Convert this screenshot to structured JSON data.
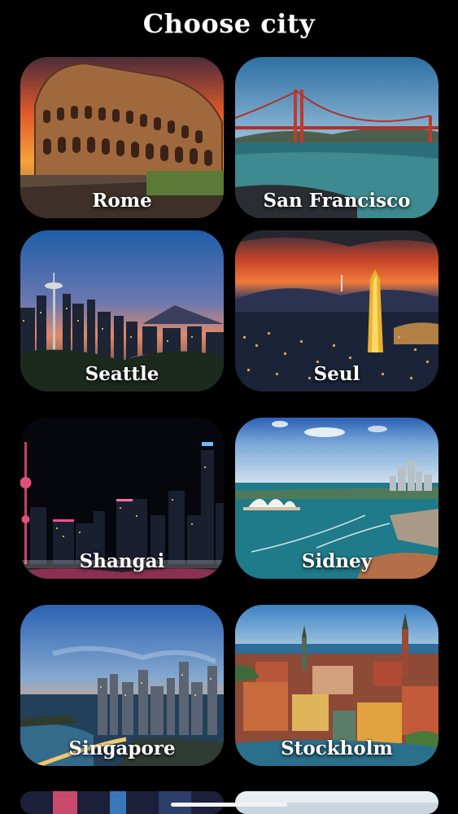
{
  "header": {
    "title": "Choose city"
  },
  "cities": [
    {
      "name": "Rome"
    },
    {
      "name": "San Francisco"
    },
    {
      "name": "Seattle"
    },
    {
      "name": "Seul"
    },
    {
      "name": "Shangai"
    },
    {
      "name": "Sidney"
    },
    {
      "name": "Singapore"
    },
    {
      "name": "Stockholm"
    }
  ],
  "colors": {
    "background": "#000000",
    "text": "#ffffff"
  }
}
